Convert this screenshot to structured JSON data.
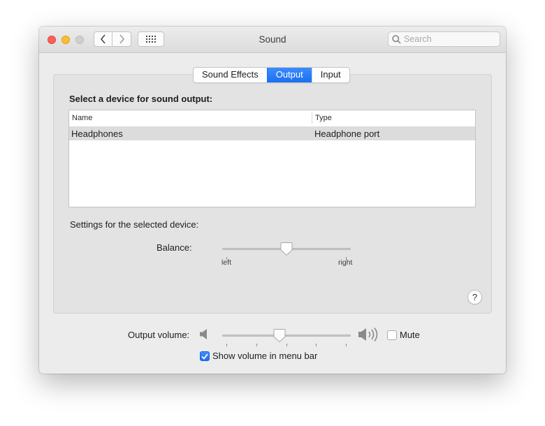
{
  "window": {
    "title": "Sound"
  },
  "search": {
    "placeholder": "Search"
  },
  "tabs": [
    {
      "label": "Sound Effects",
      "selected": false
    },
    {
      "label": "Output",
      "selected": true
    },
    {
      "label": "Input",
      "selected": false
    }
  ],
  "output": {
    "select_heading": "Select a device for sound output:",
    "table": {
      "columns": [
        "Name",
        "Type"
      ],
      "rows": [
        {
          "name": "Headphones",
          "type": "Headphone port",
          "selected": true
        }
      ]
    },
    "settings_heading": "Settings for the selected device:",
    "balance": {
      "label": "Balance:",
      "value": 0.5,
      "left_label": "left",
      "right_label": "right"
    }
  },
  "help_label": "?",
  "volume": {
    "label": "Output volume:",
    "value": 0.44,
    "mute_label": "Mute",
    "muted": false,
    "show_in_menu_bar_label": "Show volume in menu bar",
    "show_in_menu_bar": true
  },
  "colors": {
    "accent": "#1a6ff2",
    "close": "#fd5f57",
    "minimize": "#febc2e",
    "zoom": "#cfcfcf"
  }
}
